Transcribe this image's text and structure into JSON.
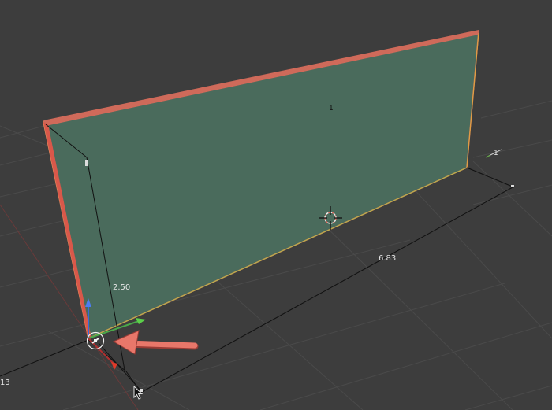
{
  "viewport": {
    "background": "#3d3d3d",
    "grid_color": "#484848",
    "face_color": "#4a6b5c",
    "selection_outline_color": "#e0865a",
    "selected_edge_color": "#d9584a",
    "annotation_color": "#e8776a"
  },
  "face_label": "1",
  "grid_number_label": "1",
  "dimensions": {
    "height_label": "2.50",
    "length_label": "6.83",
    "partial_label": "13"
  },
  "icons": {
    "cursor": "mouse-pointer-icon",
    "origin": "3d-cursor-icon",
    "pivot": "vertex-pivot-icon",
    "arrow": "red-annotation-arrow"
  }
}
